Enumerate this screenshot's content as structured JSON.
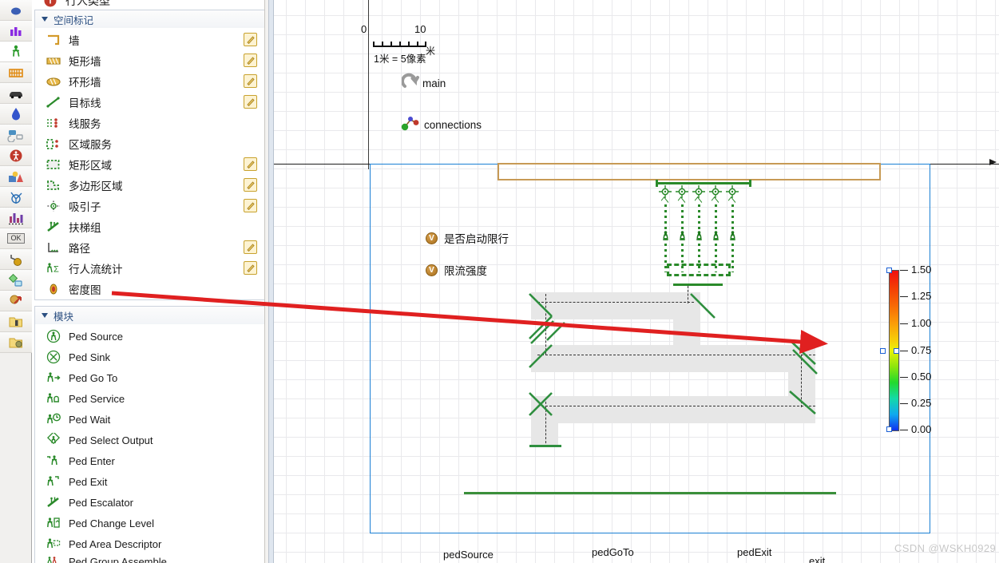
{
  "app": {
    "watermark": "CSDN @WSKH0929"
  },
  "toolbar": {
    "items": [
      {
        "name": "fluid-library-icon",
        "glyph": "●",
        "color": "#3b5fb5",
        "selected": false
      },
      {
        "name": "process-modeling-icon",
        "glyph": "◥",
        "color": "#8a2be2",
        "selected": false
      },
      {
        "name": "pedestrian-library-icon",
        "glyph": "ᾜD",
        "color": "#2a9a2a",
        "selected": true
      },
      {
        "name": "rail-library-icon",
        "glyph": "▒",
        "color": "#e08a12",
        "selected": false
      },
      {
        "name": "road-traffic-library-icon",
        "glyph": "▬",
        "color": "#333333",
        "selected": false
      },
      {
        "name": "fluid-drop-icon",
        "glyph": "●",
        "color": "#3355cc",
        "selected": false
      },
      {
        "name": "material-handling-icon",
        "glyph": "■",
        "color": "#4a90c2",
        "selected": false
      },
      {
        "name": "accessibility-icon",
        "glyph": "●",
        "color": "#c0392b",
        "selected": false
      },
      {
        "name": "presentation-icon",
        "glyph": "■",
        "color": "#e8a33d",
        "selected": false
      },
      {
        "name": "network-icon",
        "glyph": "○",
        "color": "#2a6fb5",
        "selected": false
      },
      {
        "name": "analysis-charts-icon",
        "glyph": "▥",
        "color": "#a83d6e",
        "selected": false
      },
      {
        "name": "controls-ok-icon",
        "glyph": "OK",
        "color": "#444444",
        "selected": false
      },
      {
        "name": "connectivity-icon",
        "glyph": "●",
        "color": "#d4a017",
        "selected": false
      },
      {
        "name": "data-icon",
        "glyph": "◆",
        "color": "#4aa34a",
        "selected": false
      },
      {
        "name": "agent-icon",
        "glyph": "↗",
        "color": "#c0392b",
        "selected": false
      },
      {
        "name": "project-folder-icon",
        "glyph": "▤",
        "color": "#e0b84a",
        "selected": false
      },
      {
        "name": "library-folder-icon",
        "glyph": "▤",
        "color": "#e0b84a",
        "selected": false
      }
    ]
  },
  "palette": {
    "top_partial_item": {
      "label": "行人类型",
      "icon": "ped-type-icon"
    },
    "groups": [
      {
        "title": "空间标记",
        "name": "group-space-markup",
        "items": [
          {
            "label": "墙",
            "icon": "wall-icon",
            "editable": true,
            "lang": "cn"
          },
          {
            "label": "矩形墙",
            "icon": "rectangular-wall-icon",
            "editable": true,
            "lang": "cn"
          },
          {
            "label": "环形墙",
            "icon": "circular-wall-icon",
            "editable": true,
            "lang": "cn"
          },
          {
            "label": "目标线",
            "icon": "target-line-icon",
            "editable": true,
            "lang": "cn"
          },
          {
            "label": "线服务",
            "icon": "line-service-icon",
            "editable": false,
            "lang": "cn"
          },
          {
            "label": "区域服务",
            "icon": "area-service-icon",
            "editable": false,
            "lang": "cn"
          },
          {
            "label": "矩形区域",
            "icon": "rectangular-area-icon",
            "editable": true,
            "lang": "cn"
          },
          {
            "label": "多边形区域",
            "icon": "polygonal-area-icon",
            "editable": true,
            "lang": "cn"
          },
          {
            "label": "吸引子",
            "icon": "attractor-icon",
            "editable": true,
            "lang": "cn"
          },
          {
            "label": "扶梯组",
            "icon": "escalator-group-icon",
            "editable": false,
            "lang": "cn"
          },
          {
            "label": "路径",
            "icon": "pathway-icon",
            "editable": true,
            "lang": "cn"
          },
          {
            "label": "行人流统计",
            "icon": "ped-flow-statistics-icon",
            "editable": true,
            "lang": "cn"
          },
          {
            "label": "密度图",
            "icon": "density-map-icon",
            "editable": false,
            "lang": "cn"
          }
        ]
      },
      {
        "title": "模块",
        "name": "group-blocks",
        "items": [
          {
            "label": "Ped Source",
            "icon": "ped-source-icon",
            "editable": false,
            "lang": "en"
          },
          {
            "label": "Ped Sink",
            "icon": "ped-sink-icon",
            "editable": false,
            "lang": "en"
          },
          {
            "label": "Ped Go To",
            "icon": "ped-go-to-icon",
            "editable": false,
            "lang": "en"
          },
          {
            "label": "Ped Service",
            "icon": "ped-service-icon",
            "editable": false,
            "lang": "en"
          },
          {
            "label": "Ped Wait",
            "icon": "ped-wait-icon",
            "editable": false,
            "lang": "en"
          },
          {
            "label": "Ped Select Output",
            "icon": "ped-select-output-icon",
            "editable": false,
            "lang": "en"
          },
          {
            "label": "Ped Enter",
            "icon": "ped-enter-icon",
            "editable": false,
            "lang": "en"
          },
          {
            "label": "Ped Exit",
            "icon": "ped-exit-icon",
            "editable": false,
            "lang": "en"
          },
          {
            "label": "Ped Escalator",
            "icon": "ped-escalator-icon",
            "editable": false,
            "lang": "en"
          },
          {
            "label": "Ped Change Level",
            "icon": "ped-change-level-icon",
            "editable": false,
            "lang": "en"
          },
          {
            "label": "Ped Area Descriptor",
            "icon": "ped-area-descriptor-icon",
            "editable": false,
            "lang": "en"
          },
          {
            "label": "Ped Group Assemble",
            "icon": "ped-group-assemble-icon",
            "editable": false,
            "lang": "en"
          }
        ]
      }
    ]
  },
  "canvas": {
    "scale_ruler": {
      "tick_start": "0",
      "tick_end": "10",
      "unit": "米",
      "caption": "1米 = 5像素"
    },
    "embedded_objects": [
      {
        "name": "main",
        "label": "main"
      },
      {
        "name": "connections",
        "label": "connections"
      }
    ],
    "variables": [
      {
        "name": "variable-enable-restriction",
        "badge": "V",
        "label": "是否启动限行"
      },
      {
        "name": "variable-restriction-rate",
        "badge": "V",
        "label": "限流强度"
      }
    ],
    "object_labels": [
      {
        "name": "label-pedSource",
        "label": "pedSource"
      },
      {
        "name": "label-pedGoTo",
        "label": "pedGoTo"
      },
      {
        "name": "label-pedExit",
        "label": "pedExit"
      },
      {
        "name": "label-exit",
        "label": "exit"
      }
    ]
  },
  "chart_data": {
    "type": "heatmap",
    "title": "",
    "subtitle": "",
    "legend_position": "right",
    "grid": true,
    "colorbar": {
      "name": "density-map-colorbar",
      "orientation": "vertical",
      "min": 0.0,
      "max": 1.5,
      "tick_labels": [
        "1.50",
        "1.25",
        "1.00",
        "0.75",
        "0.50",
        "0.25",
        "0.00"
      ],
      "tick_values": [
        1.5,
        1.25,
        1.0,
        0.75,
        0.5,
        0.25,
        0.0
      ],
      "colors_top_to_bottom": [
        "#f01010",
        "#f76a06",
        "#fb9d08",
        "#e9f20a",
        "#22d92e",
        "#14d9a8",
        "#1030f0"
      ],
      "handles_at": [
        1.5,
        0.75,
        0.0
      ],
      "unit": ""
    },
    "model_colors": {
      "wall": "#c79a55",
      "markup_green": "#2a8a2a",
      "selection_blue": "#1a7fd4",
      "annotation_red": "#e02020",
      "corridor_fill": "#e7e7e7"
    }
  }
}
